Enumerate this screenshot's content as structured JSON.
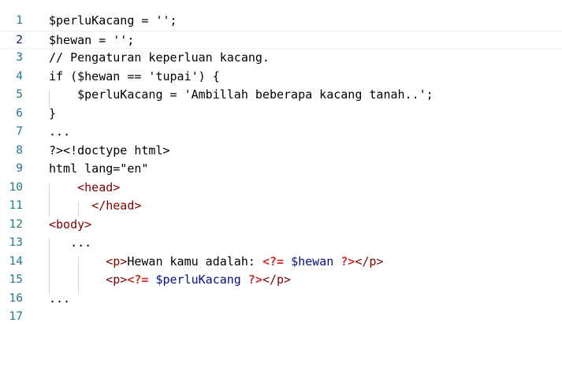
{
  "editor": {
    "current_line": 2,
    "lines": [
      {
        "number": "1",
        "segments": [
          {
            "text": "$perluKacang = '';"
          }
        ]
      },
      {
        "number": "2",
        "segments": [
          {
            "text": "$hewan = '';"
          }
        ]
      },
      {
        "number": "3",
        "segments": [
          {
            "text": "// Pengaturan keperluan kacang."
          }
        ]
      },
      {
        "number": "4",
        "segments": [
          {
            "text": "if ($hewan == 'tupai') {"
          }
        ]
      },
      {
        "number": "5",
        "segments": [
          {
            "text": "    $perluKacang = 'Ambillah beberapa kacang tanah..';"
          }
        ]
      },
      {
        "number": "6",
        "segments": [
          {
            "text": "}"
          }
        ]
      },
      {
        "number": "7",
        "segments": [
          {
            "text": "..."
          }
        ]
      },
      {
        "number": "8",
        "segments": [
          {
            "text": "?><!doctype html>"
          }
        ]
      },
      {
        "number": "9",
        "segments": [
          {
            "text": "html lang=\"en\""
          }
        ]
      },
      {
        "number": "10",
        "segments": [
          {
            "text": "    "
          },
          {
            "text": "<head>",
            "kind": "tag"
          }
        ]
      },
      {
        "number": "11",
        "segments": [
          {
            "text": "      "
          },
          {
            "text": "</head>",
            "kind": "tag"
          }
        ]
      },
      {
        "number": "12",
        "segments": [
          {
            "text": "<body>",
            "kind": "tag"
          }
        ]
      },
      {
        "number": "13",
        "segments": [
          {
            "text": "   ..."
          }
        ]
      },
      {
        "number": "14",
        "segments": [
          {
            "text": "        "
          },
          {
            "text": "<p>",
            "kind": "tag"
          },
          {
            "text": "Hewan kamu adalah: "
          },
          {
            "text": "<?=",
            "kind": "php"
          },
          {
            "text": " "
          },
          {
            "text": "$hewan",
            "kind": "var"
          },
          {
            "text": " "
          },
          {
            "text": "?>",
            "kind": "php"
          },
          {
            "text": "</p>",
            "kind": "tag"
          }
        ]
      },
      {
        "number": "15",
        "segments": [
          {
            "text": "        "
          },
          {
            "text": "<p>",
            "kind": "tag"
          },
          {
            "text": "<?=",
            "kind": "php"
          },
          {
            "text": " "
          },
          {
            "text": "$perluKacang",
            "kind": "var"
          },
          {
            "text": " "
          },
          {
            "text": "?>",
            "kind": "php"
          },
          {
            "text": "</p>",
            "kind": "tag"
          }
        ]
      },
      {
        "number": "16",
        "segments": [
          {
            "text": "..."
          }
        ]
      },
      {
        "number": "17",
        "segments": []
      }
    ]
  }
}
